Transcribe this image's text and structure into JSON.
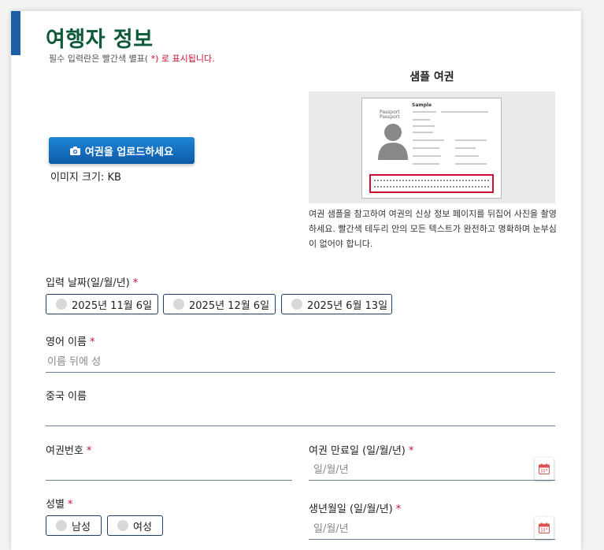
{
  "header": {
    "title": "여행자 정보",
    "required_note_prefix": "필수 입력란은 빨간색 별표(",
    "required_note_star": " *)",
    "required_note_suffix": " 로 표시됩니다."
  },
  "sample": {
    "title": "샘플 여권",
    "passport_word": "Passport",
    "passport_word2": "Passport",
    "sample_word": "Sample",
    "description": "여권 샘플을 참고하여 여권의 신상 정보 페이지를 뒤집어 사진을 촬영하세요. 빨간색 테두리 안의 모든 텍스트가 완전하고 명확하며 눈부심이 없어야 합니다."
  },
  "upload": {
    "button_label": "여권을 업로드하세요",
    "image_size": "이미지 크기: KB"
  },
  "entry_date": {
    "label": "입력 날짜(일/월/년)",
    "options": [
      "2025년 11월 6일",
      "2025년 12월 6일",
      "2025년 6월 13일"
    ]
  },
  "english_name": {
    "label": "영어 이름",
    "placeholder": "이름 뒤에 성"
  },
  "chinese_name": {
    "label": "중국 이름",
    "value": ""
  },
  "passport_number": {
    "label": "여권번호",
    "value": ""
  },
  "passport_expiry": {
    "label": "여권 만료일 (일/월/년)",
    "placeholder": "일/월/년"
  },
  "gender": {
    "label": "성별",
    "options": [
      "남성",
      "여성"
    ]
  },
  "birth_date": {
    "label": "생년월일 (일/월/년)",
    "placeholder": "일/월/년"
  },
  "colors": {
    "title_green": "#0d5a3a",
    "accent_blue": "#1f5fa8",
    "required_red": "#c8102e",
    "border_navy": "#1b3f66"
  }
}
